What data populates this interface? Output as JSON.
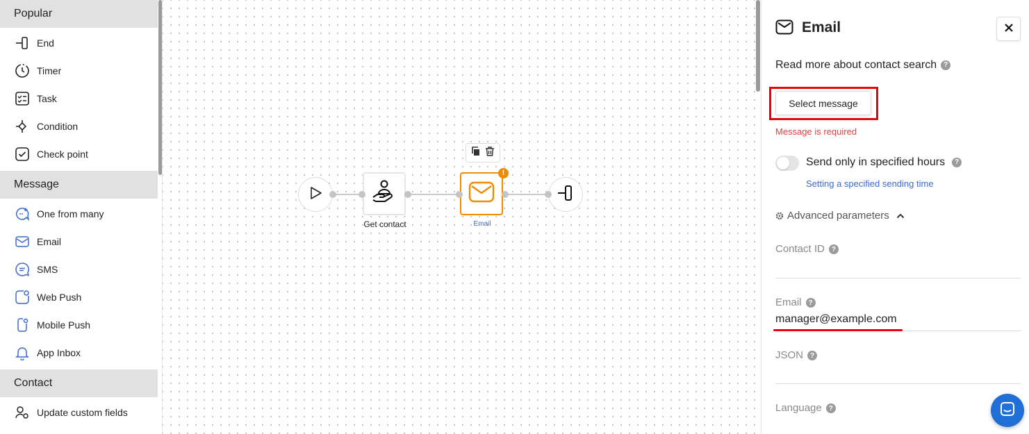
{
  "sidebar": {
    "sections": [
      {
        "title": "Popular",
        "items": [
          {
            "label": "End",
            "icon": "end-icon"
          },
          {
            "label": "Timer",
            "icon": "timer-icon"
          },
          {
            "label": "Task",
            "icon": "task-icon"
          },
          {
            "label": "Condition",
            "icon": "condition-icon"
          },
          {
            "label": "Check point",
            "icon": "check-point-icon"
          }
        ]
      },
      {
        "title": "Message",
        "items": [
          {
            "label": "One from many",
            "icon": "one-from-many-icon"
          },
          {
            "label": "Email",
            "icon": "email-icon"
          },
          {
            "label": "SMS",
            "icon": "sms-icon"
          },
          {
            "label": "Web Push",
            "icon": "web-push-icon"
          },
          {
            "label": "Mobile Push",
            "icon": "mobile-push-icon"
          },
          {
            "label": "App Inbox",
            "icon": "app-inbox-icon"
          }
        ]
      },
      {
        "title": "Contact",
        "items": [
          {
            "label": "Update custom fields",
            "icon": "update-custom-fields-icon"
          }
        ]
      }
    ]
  },
  "canvas": {
    "nodes": [
      {
        "label": "",
        "icon": "start-play-icon"
      },
      {
        "label": "Get contact",
        "icon": "get-contact-icon"
      },
      {
        "label": "Email",
        "icon": "email-icon"
      },
      {
        "label": "",
        "icon": "end-icon"
      }
    ],
    "warning_badge": "!",
    "colors": {
      "selected": "#f08a00",
      "link_label": "#3a6ad0"
    }
  },
  "panel": {
    "title": "Email",
    "read_more": "Read more about contact search",
    "select_message": "Select message",
    "error": "Message is required",
    "send_hours_label": "Send only in specified hours",
    "send_hours_link": "Setting a specified sending time",
    "advanced": "Advanced parameters",
    "fields": {
      "contact_id": {
        "label": "Contact ID",
        "value": ""
      },
      "email": {
        "label": "Email",
        "value": "manager@example.com"
      },
      "json": {
        "label": "JSON",
        "value": ""
      },
      "language": {
        "label": "Language",
        "value": ""
      }
    },
    "help_glyph": "?"
  }
}
